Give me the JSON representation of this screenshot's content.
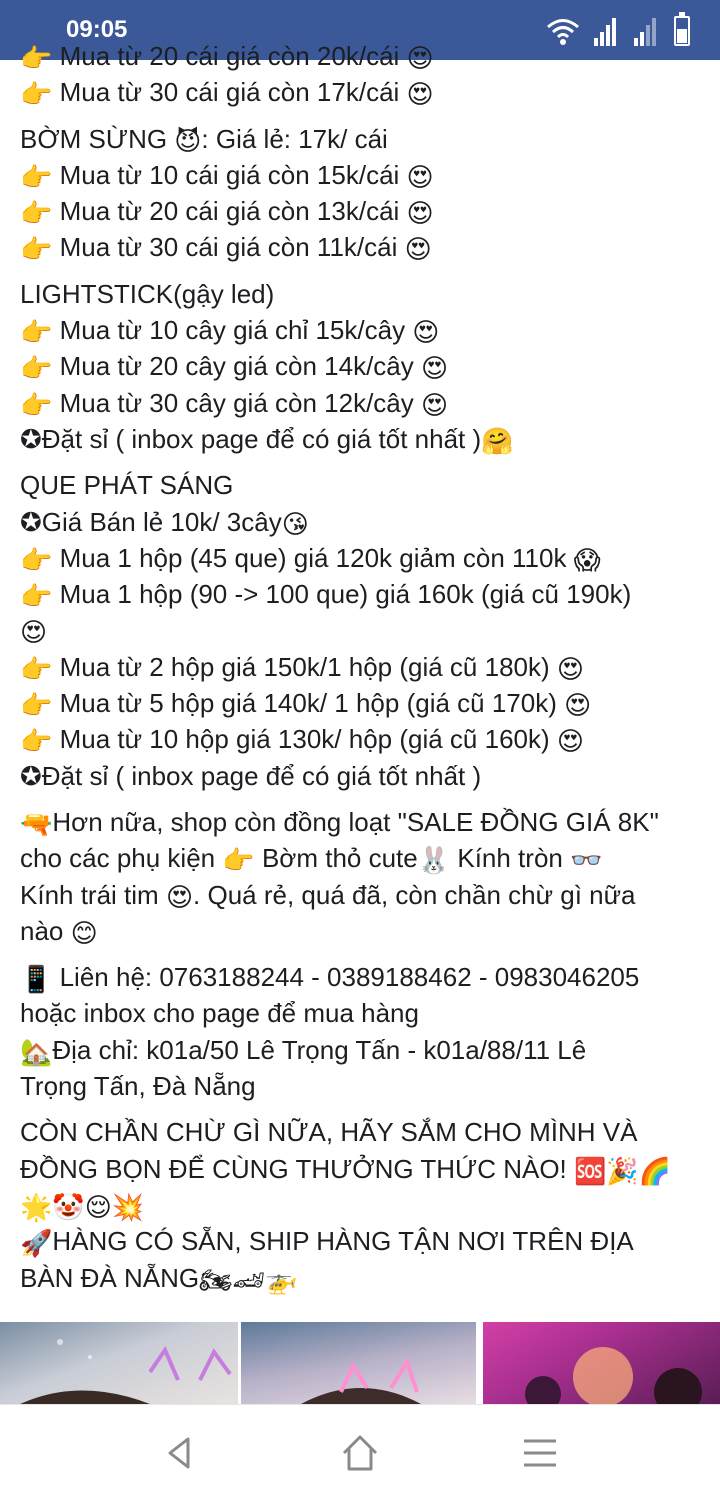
{
  "status_bar": {
    "time": "09:05",
    "icons": [
      "wifi-icon",
      "signal-icon",
      "signal-icon",
      "battery-icon"
    ]
  },
  "post": {
    "paragraphs": [
      [
        [
          {
            "t": "👉",
            "emoji": true
          },
          {
            "t": " Mua từ 20 cái giá còn 20k/cái "
          },
          {
            "t": "😍",
            "emoji": true
          }
        ],
        [
          {
            "t": "👉",
            "emoji": true
          },
          {
            "t": " Mua từ 30 cái giá còn 17k/cái "
          },
          {
            "t": "😍",
            "emoji": true
          }
        ]
      ],
      [
        [
          {
            "t": "BỜM SỪNG "
          },
          {
            "t": "😈",
            "emoji": true
          },
          {
            "t": ": Giá lẻ: 17k/ cái"
          }
        ],
        [
          {
            "t": "👉",
            "emoji": true
          },
          {
            "t": " Mua từ 10 cái giá còn 15k/cái "
          },
          {
            "t": "😍",
            "emoji": true
          }
        ],
        [
          {
            "t": "👉",
            "emoji": true
          },
          {
            "t": " Mua từ 20 cái giá còn 13k/cái "
          },
          {
            "t": "😍",
            "emoji": true
          }
        ],
        [
          {
            "t": "👉",
            "emoji": true
          },
          {
            "t": " Mua từ 30 cái giá còn 11k/cái "
          },
          {
            "t": "😍",
            "emoji": true
          }
        ]
      ],
      [
        [
          {
            "t": "LIGHTSTICK(gậy led)"
          }
        ],
        [
          {
            "t": "👉",
            "emoji": true
          },
          {
            "t": " Mua từ 10 cây giá chỉ 15k/cây "
          },
          {
            "t": "😍",
            "emoji": true
          }
        ],
        [
          {
            "t": "👉",
            "emoji": true
          },
          {
            "t": " Mua từ 20 cây giá còn 14k/cây "
          },
          {
            "t": "😍",
            "emoji": true
          }
        ],
        [
          {
            "t": "👉",
            "emoji": true
          },
          {
            "t": " Mua từ 30 cây giá còn 12k/cây "
          },
          {
            "t": "😍",
            "emoji": true
          }
        ],
        [
          {
            "t": "✪Đặt sỉ ( inbox page để có giá tốt nhất )"
          },
          {
            "t": "🤗",
            "emoji": true
          }
        ]
      ],
      [
        [
          {
            "t": "QUE PHÁT SÁNG"
          }
        ],
        [
          {
            "t": "✪Giá Bán lẻ 10k/ 3cây"
          },
          {
            "t": "😘",
            "emoji": true
          }
        ],
        [
          {
            "t": "👉",
            "emoji": true
          },
          {
            "t": " Mua 1 hộp (45 que) giá 120k giảm còn 110k "
          },
          {
            "t": "😱",
            "emoji": true
          }
        ],
        [
          {
            "t": "👉",
            "emoji": true
          },
          {
            "t": " Mua 1 hộp (90 -> 100 que) giá 160k (giá cũ 190k)"
          }
        ],
        [
          {
            "t": "😍",
            "emoji": true
          }
        ],
        [
          {
            "t": "👉",
            "emoji": true
          },
          {
            "t": " Mua từ 2 hộp giá 150k/1 hộp (giá cũ 180k) "
          },
          {
            "t": "😍",
            "emoji": true
          }
        ],
        [
          {
            "t": "👉",
            "emoji": true
          },
          {
            "t": " Mua từ 5 hộp giá 140k/ 1 hộp (giá cũ 170k) "
          },
          {
            "t": "😍",
            "emoji": true
          }
        ],
        [
          {
            "t": "👉",
            "emoji": true
          },
          {
            "t": " Mua từ 10 hộp giá 130k/ hộp (giá cũ 160k) "
          },
          {
            "t": "😍",
            "emoji": true
          }
        ],
        [
          {
            "t": "✪Đặt sỉ ( inbox page để có giá tốt nhất )"
          }
        ]
      ],
      [
        [
          {
            "t": "🔫",
            "emoji": true
          },
          {
            "t": "Hơn nữa, shop còn đồng loạt \"SALE ĐỒNG GIÁ 8K\""
          }
        ],
        [
          {
            "t": "cho các phụ kiện "
          },
          {
            "t": "👉",
            "emoji": true
          },
          {
            "t": " Bờm thỏ cute"
          },
          {
            "t": "🐰",
            "emoji": true
          },
          {
            "t": " Kính tròn "
          },
          {
            "t": "👓",
            "emoji": true
          }
        ],
        [
          {
            "t": "Kính trái tim "
          },
          {
            "t": "😍",
            "emoji": true
          },
          {
            "t": ". Quá rẻ, quá đã, còn chần chừ gì nữa"
          }
        ],
        [
          {
            "t": "nào "
          },
          {
            "t": "😊",
            "emoji": true
          }
        ]
      ],
      [
        [
          {
            "t": "📱",
            "emoji": true
          },
          {
            "t": " Liên hệ: 0763188244 - 0389188462 - 0983046205"
          }
        ],
        [
          {
            "t": "hoặc inbox cho page để mua hàng"
          }
        ],
        [
          {
            "t": "🏡",
            "emoji": true
          },
          {
            "t": "Địa chỉ: k01a/50 Lê Trọng Tấn - k01a/88/11 Lê"
          }
        ],
        [
          {
            "t": "Trọng Tấn, Đà Nẵng"
          }
        ]
      ],
      [
        [
          {
            "t": "CÒN CHẦN CHỪ GÌ NỮA, HÃY SẮM CHO MÌNH VÀ"
          }
        ],
        [
          {
            "t": "ĐỒNG BỌN ĐỂ CÙNG THƯỞNG THỨC NÀO! "
          },
          {
            "t": "🆘",
            "emoji": true
          },
          {
            "t": "🎉",
            "emoji": true
          },
          {
            "t": "🌈",
            "emoji": true
          }
        ],
        [
          {
            "t": "🌟",
            "emoji": true
          },
          {
            "t": "🤡",
            "emoji": true
          },
          {
            "t": "😌",
            "emoji": true
          },
          {
            "t": "💥",
            "emoji": true
          }
        ],
        [
          {
            "t": "🚀",
            "emoji": true
          },
          {
            "t": "HÀNG CÓ SẴN, SHIP HÀNG TẬN NƠI TRÊN ĐỊA"
          }
        ],
        [
          {
            "t": "BÀN ĐÀ NẴNG"
          },
          {
            "t": "🏍",
            "emoji": true
          },
          {
            "t": "🏎",
            "emoji": true
          },
          {
            "t": "🚁",
            "emoji": true
          }
        ]
      ]
    ]
  },
  "photos": [
    "photo-thumbnail-1",
    "photo-thumbnail-2",
    "photo-thumbnail-3"
  ],
  "nav_bar": {
    "buttons": [
      "back-icon",
      "home-icon",
      "menu-icon"
    ]
  },
  "colors": {
    "status_bar_bg": "#3b5998",
    "text": "#1c1e21",
    "nav_icon": "#8a8a8a"
  }
}
